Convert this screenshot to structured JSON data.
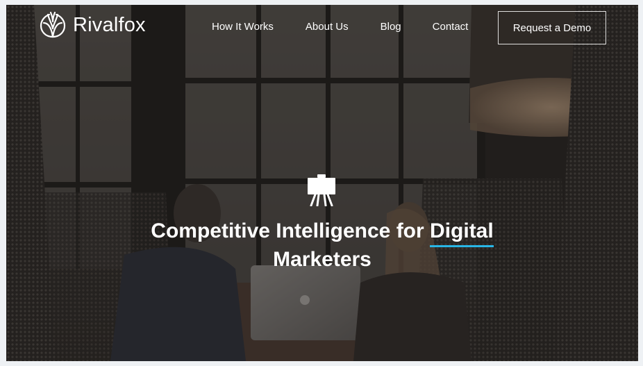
{
  "brand": {
    "name": "Rivalfox",
    "logo_icon": "leaf-logo-icon"
  },
  "nav": {
    "links": [
      "How It Works",
      "About Us",
      "Blog",
      "Contact"
    ],
    "cta_label": "Request a Demo"
  },
  "hero": {
    "icon": "presentation-board-icon",
    "headline_part1": "Competitive Intelligence for",
    "headline_accent": "Digital",
    "headline_part2": "Marketers"
  },
  "colors": {
    "accent_underline": "#29b6e6",
    "text": "#ffffff",
    "overlay": "#2f2b27"
  }
}
